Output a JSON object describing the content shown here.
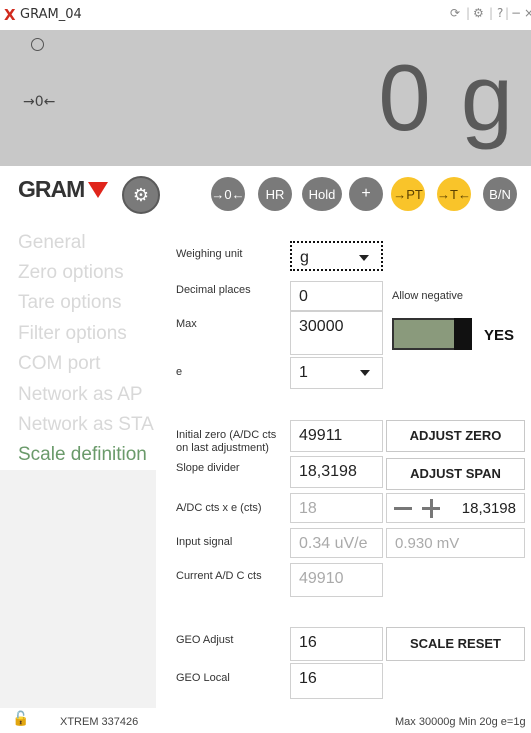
{
  "window": {
    "title": "GRAM_04",
    "controls": [
      "?",
      "−",
      "×"
    ]
  },
  "display": {
    "zero_indicator": "→0←",
    "weight": "0 g"
  },
  "toolbar": {
    "logo": "GRAM",
    "buttons": [
      "→0←",
      "HR",
      "Hold",
      "+",
      "→PT",
      "→T←",
      "B/N"
    ],
    "accent_yellow": "#f9c42a",
    "button_gray": "#7a7a7a"
  },
  "sidebar": {
    "items": [
      "General",
      "Zero options",
      "Tare options",
      "Filter options",
      "COM port",
      "Network as AP",
      "Network as STA",
      "Scale definition"
    ],
    "active_index": 7
  },
  "form": {
    "weighing_unit": {
      "label": "Weighing unit",
      "value": "g"
    },
    "decimal_places": {
      "label": "Decimal places",
      "value": "0"
    },
    "allow_negative": {
      "label": "Allow negative",
      "state": "YES"
    },
    "max": {
      "label": "Max",
      "value": "30000"
    },
    "e": {
      "label": "e",
      "value": "1"
    },
    "initial_zero": {
      "label": "Initial zero (A/DC cts on last adjustment)",
      "value": "49911"
    },
    "slope_divider": {
      "label": "Slope divider",
      "value": "18,3198"
    },
    "adc_cts_x_e": {
      "label": "A/DC cts x e (cts)",
      "value": "18",
      "stepper_value": "18,3198"
    },
    "input_signal": {
      "label": "Input signal",
      "value": "0.34 uV/e",
      "value2": "0.930 mV"
    },
    "current_adc": {
      "label": "Current A/D C cts",
      "value": "49910"
    },
    "geo_adjust": {
      "label": "GEO Adjust",
      "value": "16"
    },
    "geo_local": {
      "label": "GEO Local",
      "value": "16"
    },
    "adjust_zero_label": "ADJUST ZERO",
    "adjust_span_label": "ADJUST SPAN",
    "scale_reset_label": "SCALE RESET"
  },
  "statusbar": {
    "left": "XTREM  337426",
    "right": "Max 30000g  Min 20g  e=1g"
  }
}
